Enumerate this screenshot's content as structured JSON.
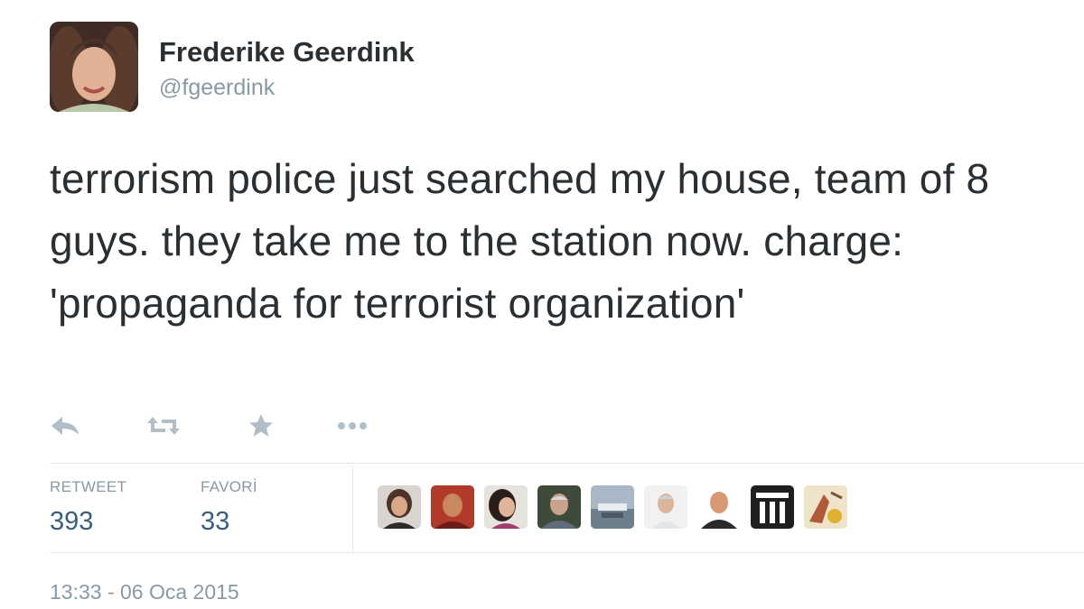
{
  "user": {
    "display_name": "Frederike Geerdink",
    "handle": "@fgeerdink"
  },
  "tweet": {
    "text": "terrorism police just searched my house, team of 8 guys. they take me to the station now. charge: 'propaganda for terrorist organization'"
  },
  "actions": [
    {
      "name": "reply-icon"
    },
    {
      "name": "retweet-icon"
    },
    {
      "name": "favorite-star-icon"
    },
    {
      "name": "more-dots-icon"
    }
  ],
  "stats": {
    "retweet_label": "RETWEET",
    "retweet_count": "393",
    "favorite_label": "FAVORİ",
    "favorite_count": "33"
  },
  "favoriters_count_shown": 9,
  "timestamp": "13:33 - 06 Oca 2015",
  "colors": {
    "text": "#292f33",
    "muted": "#8899a6",
    "count": "#3b5d7f",
    "divider": "#e1e8ed"
  }
}
